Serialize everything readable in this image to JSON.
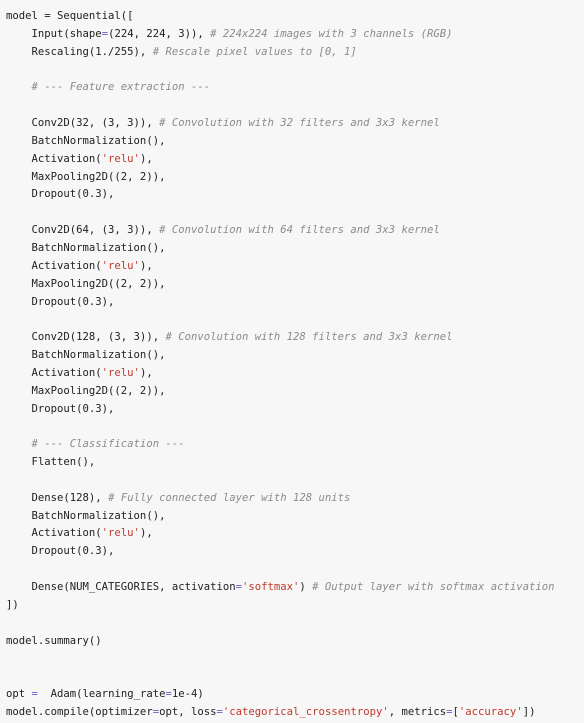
{
  "theme": {
    "background": "#f7f7f7",
    "text": "#212121",
    "comment": "#8b8b8b",
    "string": "#c0392b",
    "operator": "#6b5cc4"
  },
  "code_lines": [
    [
      {
        "t": "model = Sequential([",
        "c": ""
      }
    ],
    [
      {
        "t": "    Input(shape",
        "c": ""
      },
      {
        "t": "=",
        "c": "op"
      },
      {
        "t": "(224, 224, 3)), ",
        "c": ""
      },
      {
        "t": "# 224x224 images with 3 channels (RGB)",
        "c": "cm"
      }
    ],
    [
      {
        "t": "    Rescaling(1./255), ",
        "c": ""
      },
      {
        "t": "# Rescale pixel values to [0, 1]",
        "c": "cm"
      }
    ],
    [],
    [
      {
        "t": "    # --- Feature extraction ---",
        "c": "cm"
      }
    ],
    [],
    [
      {
        "t": "    Conv2D(32, (3, 3)), ",
        "c": ""
      },
      {
        "t": "# Convolution with 32 filters and 3x3 kernel",
        "c": "cm"
      }
    ],
    [
      {
        "t": "    BatchNormalization(),",
        "c": ""
      }
    ],
    [
      {
        "t": "    Activation(",
        "c": ""
      },
      {
        "t": "'relu'",
        "c": "str"
      },
      {
        "t": "),",
        "c": ""
      }
    ],
    [
      {
        "t": "    MaxPooling2D((2, 2)),",
        "c": ""
      }
    ],
    [
      {
        "t": "    Dropout(0.3),",
        "c": ""
      }
    ],
    [],
    [
      {
        "t": "    Conv2D(64, (3, 3)), ",
        "c": ""
      },
      {
        "t": "# Convolution with 64 filters and 3x3 kernel",
        "c": "cm"
      }
    ],
    [
      {
        "t": "    BatchNormalization(),",
        "c": ""
      }
    ],
    [
      {
        "t": "    Activation(",
        "c": ""
      },
      {
        "t": "'relu'",
        "c": "str"
      },
      {
        "t": "),",
        "c": ""
      }
    ],
    [
      {
        "t": "    MaxPooling2D((2, 2)),",
        "c": ""
      }
    ],
    [
      {
        "t": "    Dropout(0.3),",
        "c": ""
      }
    ],
    [],
    [
      {
        "t": "    Conv2D(128, (3, 3)), ",
        "c": ""
      },
      {
        "t": "# Convolution with 128 filters and 3x3 kernel",
        "c": "cm"
      }
    ],
    [
      {
        "t": "    BatchNormalization(),",
        "c": ""
      }
    ],
    [
      {
        "t": "    Activation(",
        "c": ""
      },
      {
        "t": "'relu'",
        "c": "str"
      },
      {
        "t": "),",
        "c": ""
      }
    ],
    [
      {
        "t": "    MaxPooling2D((2, 2)),",
        "c": ""
      }
    ],
    [
      {
        "t": "    Dropout(0.3),",
        "c": ""
      }
    ],
    [],
    [
      {
        "t": "    # --- Classification ---",
        "c": "cm"
      }
    ],
    [
      {
        "t": "    Flatten(),",
        "c": ""
      }
    ],
    [],
    [
      {
        "t": "    Dense(128), ",
        "c": ""
      },
      {
        "t": "# Fully connected layer with 128 units",
        "c": "cm"
      }
    ],
    [
      {
        "t": "    BatchNormalization(),",
        "c": ""
      }
    ],
    [
      {
        "t": "    Activation(",
        "c": ""
      },
      {
        "t": "'relu'",
        "c": "str"
      },
      {
        "t": "),",
        "c": ""
      }
    ],
    [
      {
        "t": "    Dropout(0.3),",
        "c": ""
      }
    ],
    [],
    [
      {
        "t": "    Dense(NUM_CATEGORIES, activation",
        "c": ""
      },
      {
        "t": "=",
        "c": "op"
      },
      {
        "t": "'softmax'",
        "c": "str"
      },
      {
        "t": ") ",
        "c": ""
      },
      {
        "t": "# Output layer with softmax activation",
        "c": "cm"
      }
    ],
    [
      {
        "t": "])",
        "c": ""
      }
    ],
    [],
    [
      {
        "t": "model.summary()",
        "c": ""
      }
    ],
    [],
    [],
    [
      {
        "t": "opt ",
        "c": ""
      },
      {
        "t": "=",
        "c": "op"
      },
      {
        "t": "  Adam(learning_rate",
        "c": ""
      },
      {
        "t": "=",
        "c": "op"
      },
      {
        "t": "1e-4)",
        "c": ""
      }
    ],
    [
      {
        "t": "model.compile(optimizer",
        "c": ""
      },
      {
        "t": "=",
        "c": "op"
      },
      {
        "t": "opt, loss",
        "c": ""
      },
      {
        "t": "=",
        "c": "op"
      },
      {
        "t": "'categorical_crossentropy'",
        "c": "str"
      },
      {
        "t": ", metrics",
        "c": ""
      },
      {
        "t": "=",
        "c": "op"
      },
      {
        "t": "[",
        "c": ""
      },
      {
        "t": "'accuracy'",
        "c": "str"
      },
      {
        "t": "])",
        "c": ""
      }
    ]
  ]
}
